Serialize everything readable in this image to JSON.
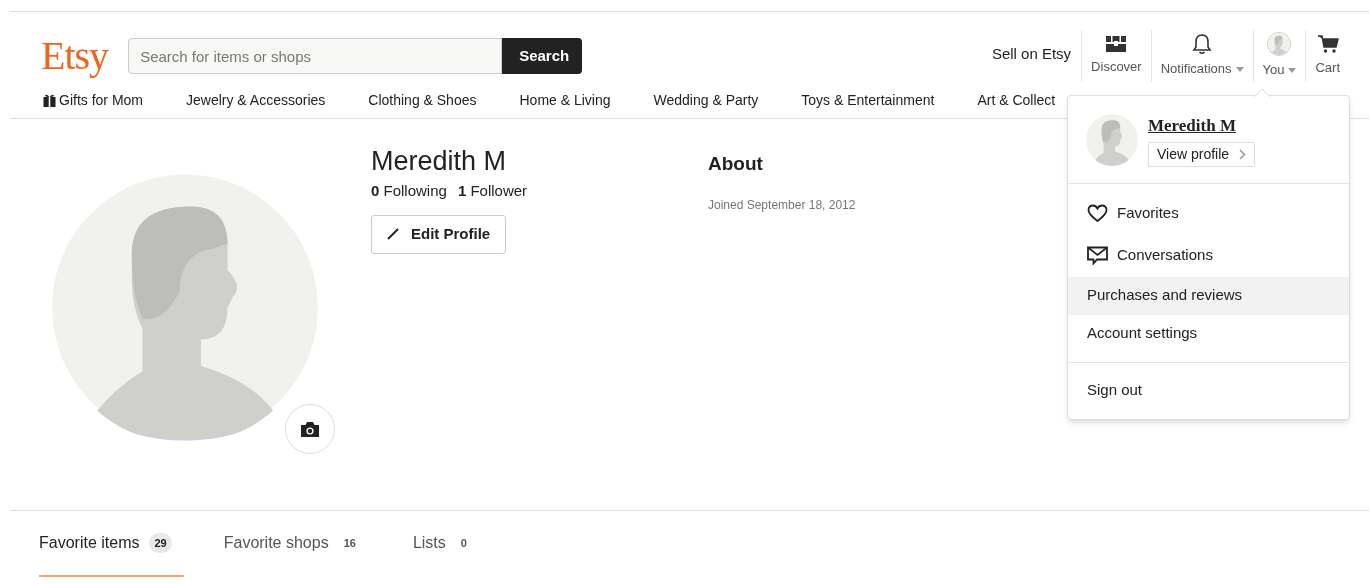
{
  "logo": "Etsy",
  "search": {
    "placeholder": "Search for items or shops",
    "button": "Search"
  },
  "sell_link": "Sell on Etsy",
  "header_items": [
    {
      "kind": "discover",
      "label": "Discover",
      "caret": false
    },
    {
      "kind": "bell",
      "label": "Notifications",
      "caret": true
    },
    {
      "kind": "avatar",
      "label": "You",
      "caret": true
    },
    {
      "kind": "cart",
      "label": "Cart",
      "caret": false
    }
  ],
  "nav": [
    {
      "kind": "gift",
      "label": "Gifts for Mom"
    },
    {
      "kind": "plain",
      "label": "Jewelry & Accessories"
    },
    {
      "kind": "plain",
      "label": "Clothing & Shoes"
    },
    {
      "kind": "plain",
      "label": "Home & Living"
    },
    {
      "kind": "plain",
      "label": "Wedding & Party"
    },
    {
      "kind": "plain",
      "label": "Toys & Entertainment"
    },
    {
      "kind": "plain",
      "label": "Art & Collect"
    }
  ],
  "profile": {
    "name": "Meredith M",
    "following": {
      "count": "0",
      "label": "Following"
    },
    "followers": {
      "count": "1",
      "label": "Follower"
    },
    "edit_button": "Edit Profile",
    "about_title": "About",
    "joined": "Joined September 18, 2012"
  },
  "dropdown": {
    "name": "Meredith M",
    "view_profile": "View profile",
    "groups": [
      [
        {
          "kind": "heart",
          "label": "Favorites",
          "highlighted": false
        },
        {
          "kind": "mail",
          "label": "Conversations",
          "highlighted": false
        },
        {
          "kind": "plain",
          "label": "Purchases and reviews",
          "highlighted": true
        },
        {
          "kind": "plain",
          "label": "Account settings",
          "highlighted": false
        }
      ],
      [
        {
          "kind": "plain",
          "label": "Sign out",
          "highlighted": false
        }
      ]
    ]
  },
  "tabs": [
    {
      "label": "Favorite items",
      "count": "29",
      "selected": true
    },
    {
      "label": "Favorite shops",
      "count": "16",
      "selected": false
    },
    {
      "label": "Lists",
      "count": "0",
      "selected": false
    }
  ]
}
